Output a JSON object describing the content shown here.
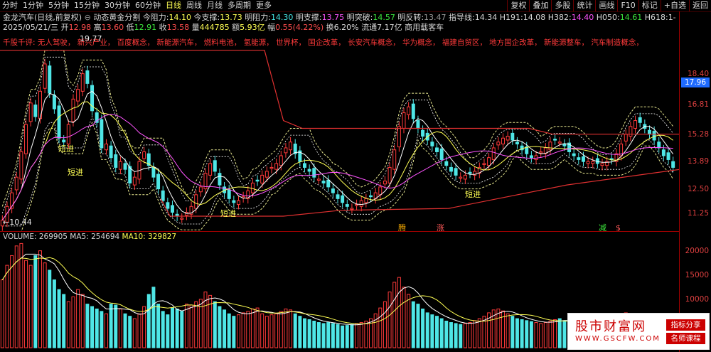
{
  "toolbar": {
    "left_items": [
      "分时",
      "1分钟",
      "5分钟",
      "15分钟",
      "30分钟",
      "60分钟",
      "日线",
      "周线",
      "月线",
      "多周期",
      "更多"
    ],
    "active": "日线",
    "right_items": [
      "复权",
      "叠加",
      "多股",
      "统计",
      "画线",
      "F10",
      "标记",
      "+自选",
      "返回"
    ]
  },
  "info": {
    "stock": "金龙汽车(日线,前复权)",
    "indicator": "动态黄金分割",
    "items": [
      {
        "label": "今阻力:",
        "value": "14.10",
        "color": "y"
      },
      {
        "label": "今支撑:",
        "value": "13.73",
        "color": "y"
      },
      {
        "label": "明阻力:",
        "value": "14.30",
        "color": "c"
      },
      {
        "label": "明支撑:",
        "value": "13.75",
        "color": "m"
      },
      {
        "label": "明突破:",
        "value": "14.57",
        "color": "g"
      },
      {
        "label": "明反转:",
        "value": "13.47",
        "color": "gr"
      },
      {
        "label": "指导线:",
        "value": "14.34",
        "color": "w"
      },
      {
        "label": "H191:",
        "value": "14.08",
        "color": "w"
      },
      {
        "label": "H382:",
        "value": "14.40",
        "color": "m"
      },
      {
        "label": "H050:",
        "value": "14.61",
        "color": "g"
      },
      {
        "label": "H618:",
        "value": "1-",
        "color": "w"
      }
    ]
  },
  "quote": {
    "date": "2025/05/21/三",
    "open_label": "开",
    "open": "12.98",
    "high_label": "高",
    "high": "13.60",
    "low_label": "低",
    "low": "12.91",
    "close_label": "收",
    "close": "13.58",
    "volume_label": "量",
    "volume": "444785",
    "amount_label": "额",
    "amount": "5.93亿",
    "change_label": "幅",
    "change": "0.55(4.22%)",
    "turnover_label": "换",
    "turnover": "6.20%",
    "float_label": "流通",
    "float": "7.17亿",
    "category": "商用载客车"
  },
  "concepts": {
    "label": "千股千评:",
    "items": [
      "无人驾驶",
      "新兴产业",
      "百度概念",
      "新能源汽车",
      "燃料电池",
      "氢能源",
      "世界杯",
      "国企改革",
      "长安汽车概念",
      "华为概念",
      "福建自贸区",
      "地方国企改革",
      "新能源整车",
      "汽车制造概念"
    ]
  },
  "annotations": {
    "max_price": "19.77",
    "min_price": "10.44",
    "short_in": "短进",
    "signals": [
      "腾",
      "涨",
      "减",
      "$"
    ]
  },
  "axis": {
    "price_ticks": [
      "18.40",
      "16.81",
      "15.28",
      "13.89",
      "12.50",
      "11.25"
    ],
    "current_price": "17.96",
    "volume_ticks": [
      "20000",
      "15000",
      "10000"
    ]
  },
  "volume": {
    "label": "VOLUME:",
    "value": "269905",
    "ma5_label": "MA5:",
    "ma5": "254694",
    "ma10_label": "MA10:",
    "ma10": "329827"
  },
  "watermark": {
    "title": "股市财富网",
    "url": "WWW.GSCFW.COM",
    "tag1": "指标分享",
    "tag2": "名师课程"
  },
  "chart_data": {
    "type": "candlestick",
    "closes": [
      10.9,
      11.6,
      12.3,
      13.1,
      14.4,
      15.8,
      16.9,
      16.2,
      17.5,
      18.9,
      17.4,
      16.6,
      15.1,
      14.9,
      15.8,
      17.1,
      17.6,
      18.4,
      17.9,
      16.5,
      15.9,
      14.6,
      14.8,
      14.1,
      13.6,
      13.9,
      13.5,
      12.8,
      13.1,
      13.9,
      14.4,
      13.7,
      13.1,
      12.5,
      11.9,
      11.5,
      11.3,
      11.1,
      11.0,
      11.3,
      11.6,
      12.2,
      12.6,
      13.3,
      13.8,
      13.4,
      12.7,
      12.3,
      12.0,
      11.8,
      11.9,
      12.1,
      12.4,
      12.8,
      12.9,
      13.2,
      13.4,
      13.6,
      13.8,
      14.2,
      14.6,
      14.9,
      14.3,
      13.9,
      13.6,
      13.4,
      13.1,
      13.0,
      12.8,
      12.6,
      12.3,
      12.0,
      11.8,
      11.6,
      11.5,
      11.7,
      11.9,
      12.0,
      12.1,
      12.3,
      12.6,
      12.9,
      13.6,
      14.5,
      15.7,
      16.4,
      16.7,
      16.1,
      15.6,
      15.2,
      15.0,
      14.7,
      14.4,
      14.0,
      13.7,
      13.4,
      13.2,
      13.1,
      13.2,
      13.3,
      13.4,
      13.6,
      13.8,
      14.1,
      14.6,
      14.9,
      15.1,
      15.2,
      15.0,
      14.8,
      14.5,
      14.3,
      14.1,
      14.2,
      14.4,
      14.6,
      14.9,
      15.0,
      14.9,
      14.7,
      14.4,
      14.2,
      14.0,
      13.9,
      13.9,
      13.9,
      13.8,
      13.8,
      13.9,
      14.0,
      14.3,
      14.8,
      15.3,
      15.7,
      16.0,
      15.9,
      15.6,
      15.3,
      15.0,
      14.6,
      14.2,
      14.0,
      13.6
    ],
    "volumes": [
      14000,
      17000,
      19000,
      21000,
      21500,
      18000,
      17000,
      19000,
      20000,
      17500,
      16000,
      14000,
      12000,
      11000,
      9500,
      10500,
      12000,
      11000,
      9000,
      8500,
      8000,
      7500,
      7000,
      9000,
      8800,
      8000,
      7000,
      6500,
      6000,
      7000,
      8500,
      11000,
      12500,
      9000,
      7500,
      6800,
      8200,
      8000,
      7500,
      9000,
      8800,
      9500,
      10000,
      11500,
      10800,
      9500,
      8500,
      7800,
      7000,
      6500,
      6800,
      7200,
      7500,
      8000,
      8200,
      7000,
      6500,
      6800,
      7000,
      7500,
      8000,
      7800,
      7000,
      6500,
      6000,
      5800,
      5500,
      5200,
      5000,
      5200,
      5000,
      4800,
      4500,
      4600,
      4800,
      5000,
      5200,
      5500,
      6000,
      7000,
      8200,
      9500,
      11500,
      13500,
      14500,
      12500,
      11000,
      9500,
      9000,
      8000,
      7200,
      6800,
      6500,
      6000,
      5500,
      5200,
      5000,
      4800,
      5000,
      5200,
      5600,
      6000,
      6500,
      7200,
      7800,
      8000,
      7600,
      7000,
      6500,
      6000,
      5800,
      5600,
      5400,
      5200,
      5000,
      5200,
      5500,
      5800,
      6000,
      5600,
      5200,
      5000,
      4800,
      4600,
      4500,
      4400,
      4500,
      4600,
      4800,
      5200,
      5800,
      6500,
      7200,
      7000,
      6500,
      6000,
      5500,
      5200,
      5000,
      4800,
      4600,
      4500,
      4800
    ]
  }
}
